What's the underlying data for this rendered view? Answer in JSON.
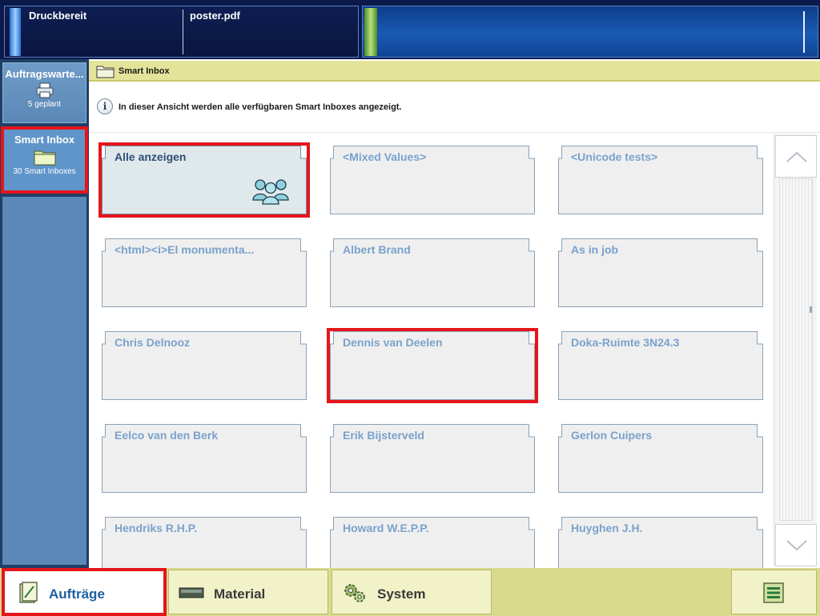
{
  "status": {
    "printer_state": "Druckbereit",
    "current_file": "poster.pdf"
  },
  "sidebar": {
    "items": [
      {
        "title": "Auftragswarte...",
        "sub": "5 geplant",
        "icon": "printer-icon"
      },
      {
        "title": "Smart Inbox",
        "sub": "30 Smart Inboxes",
        "icon": "folder-icon",
        "selected": true
      }
    ]
  },
  "main": {
    "breadcrumb": "Smart Inbox",
    "info_text": "In dieser Ansicht werden alle verfügbaren Smart Inboxes angezeigt.",
    "inboxes": [
      {
        "label": "Alle anzeigen",
        "selected": true,
        "icon": "people-group-icon"
      },
      {
        "label": "<Mixed Values>"
      },
      {
        "label": "<Unicode tests>"
      },
      {
        "label": "<html><i>El monumenta..."
      },
      {
        "label": "Albert Brand"
      },
      {
        "label": "As in job"
      },
      {
        "label": "Chris Delnooz"
      },
      {
        "label": "Dennis van Deelen"
      },
      {
        "label": "Doka-Ruimte 3N24.3"
      },
      {
        "label": "Eelco van den Berk"
      },
      {
        "label": "Erik Bijsterveld"
      },
      {
        "label": "Gerlon Cuipers"
      },
      {
        "label": "Hendriks R.H.P."
      },
      {
        "label": "Howard W.E.P.P."
      },
      {
        "label": "Huyghen J.H."
      }
    ]
  },
  "bottom_nav": {
    "tabs": [
      {
        "label": "Aufträge",
        "icon": "jobs-icon",
        "active": true
      },
      {
        "label": "Material",
        "icon": "material-icon"
      },
      {
        "label": "System",
        "icon": "system-gears-icon"
      }
    ],
    "menu_icon": "menu-icon"
  },
  "colors": {
    "highlight": "#e5151c",
    "accent_yellow": "#e3e49a",
    "label_blue": "#7aa2cc"
  }
}
